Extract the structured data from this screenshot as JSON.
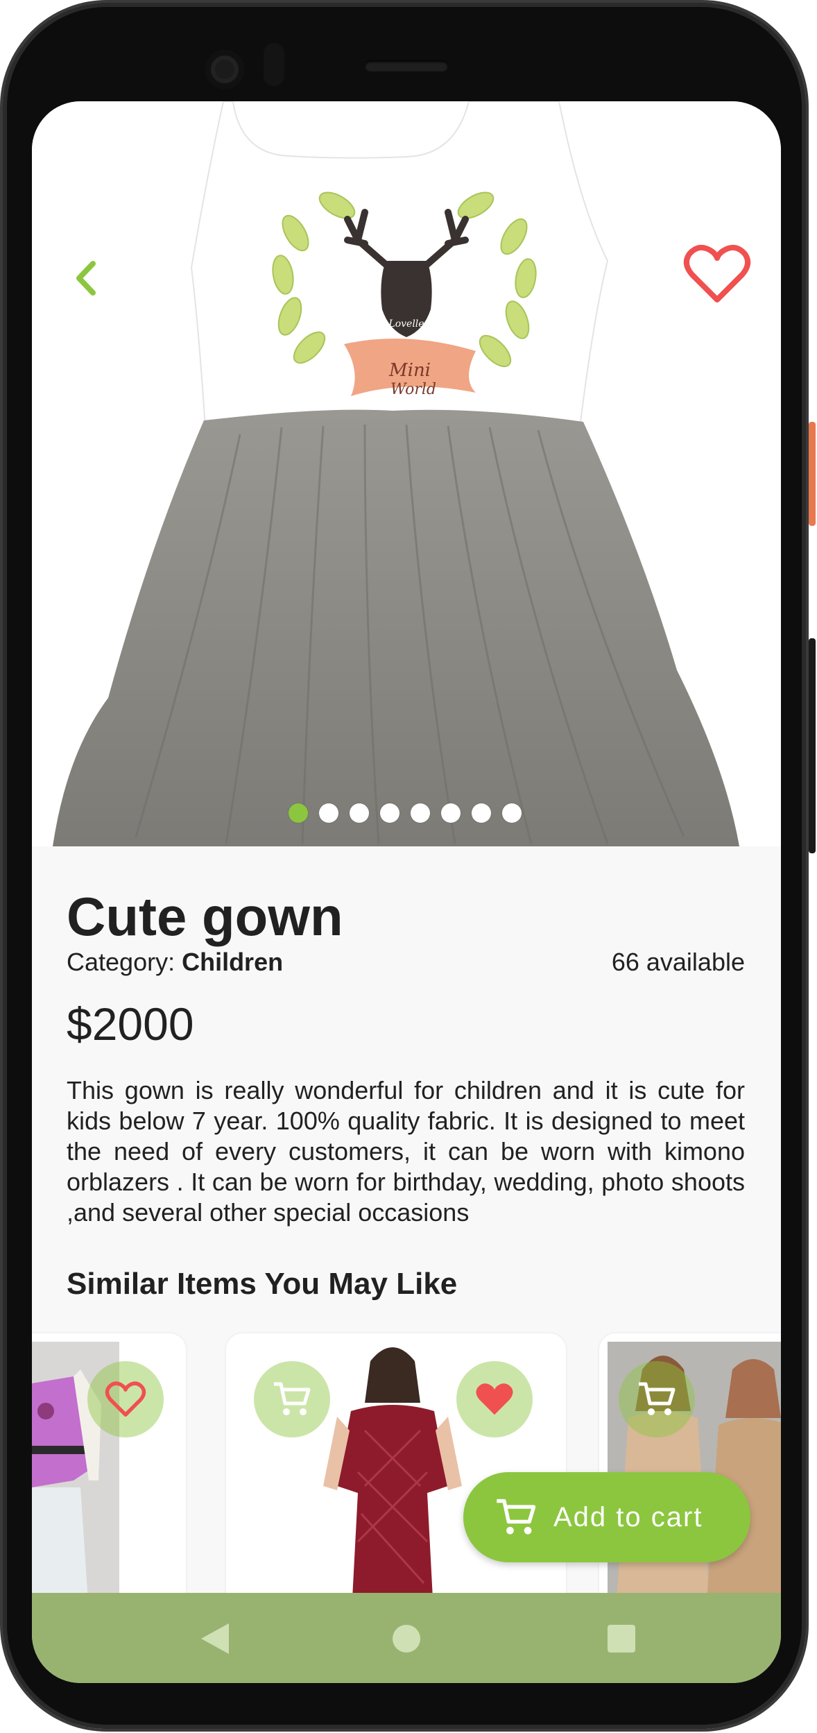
{
  "product": {
    "name": "Cute gown",
    "category_label": "Category: ",
    "category": "Children",
    "available": "66 available",
    "price": "$2000",
    "description": "This gown is really wonderful for children and it is cute for kids below 7 year. 100% quality fabric. It is designed to meet the need of every customers, it can be worn with kimono orblazers . It can be worn for birthday, wedding, photo shoots ,and  several other special occasions",
    "print_text_1": "Lovelle",
    "print_text_2": "Mini",
    "print_text_3": "World"
  },
  "carousel": {
    "total_slides": 8,
    "active_index": 0
  },
  "similar": {
    "heading": "Similar Items You May Like"
  },
  "actions": {
    "add_to_cart": "Add to cart"
  },
  "colors": {
    "accent": "#8cc63f",
    "heart": "#f0504f",
    "navbar": "#98b370"
  },
  "icons": {
    "back": "chevron-left-icon",
    "favorite": "heart-outline-icon",
    "cart": "cart-icon",
    "heart_filled": "heart-filled-icon"
  }
}
